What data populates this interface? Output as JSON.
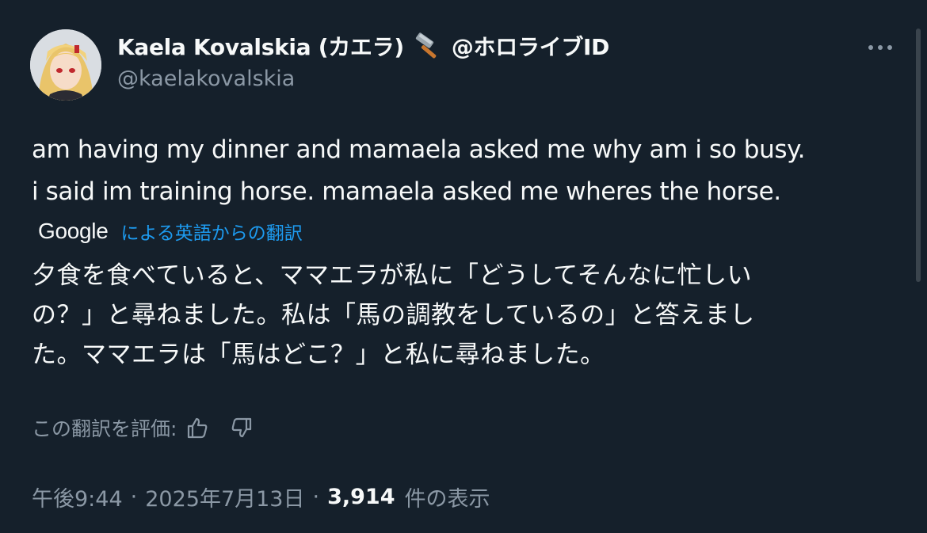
{
  "tweet": {
    "author": {
      "display_name": "Kaela Kovalskia (カエラ)",
      "emoji_icon": "hammer-icon",
      "affiliation": "@ホロライブID",
      "handle": "@kaelakovalskia",
      "avatar": "avatar-image"
    },
    "text_lines": [
      "am having my dinner and mamaela asked me why am i so busy.",
      "i said im training horse. mamaela asked me wheres the horse."
    ],
    "translation": {
      "provider": "Google",
      "link_text": "による英語からの翻訳",
      "lines": [
        "夕食を食べていると、ママエラが私に「どうしてそんなに忙しい",
        "の？」と尋ねました。私は「馬の調教をしているの」と答えまし",
        "た。ママエラは「馬はどこ？」と私に尋ねました。"
      ],
      "rate_label": "この翻訳を評価:"
    },
    "meta": {
      "time": "午後9:44",
      "separator": "·",
      "date": "2025年7月13日",
      "views_count": "3,914",
      "views_label": "件の表示"
    }
  },
  "colors": {
    "background": "#15202b",
    "text": "#f7f9f9",
    "secondary": "#8b98a5",
    "link": "#1d9bf0"
  }
}
